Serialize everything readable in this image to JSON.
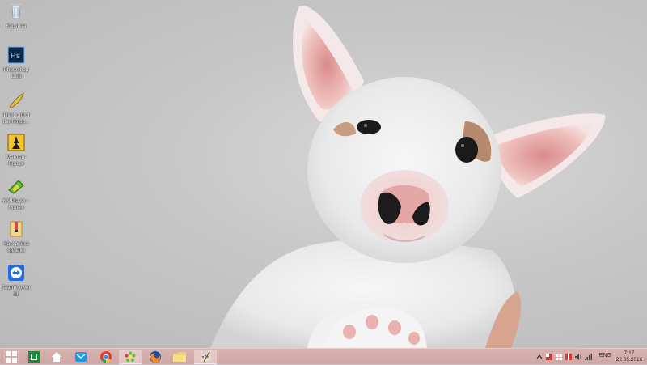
{
  "desktop": {
    "icons": [
      {
        "name": "recycle-bin",
        "label": "Корзина"
      },
      {
        "name": "photoshop",
        "label": "Photoshop CS6"
      },
      {
        "name": "lord-of-the-rings-game",
        "label": "The Lord of the Rings..."
      },
      {
        "name": "master-game",
        "label": "Мастер-Ярлык"
      },
      {
        "name": "kmplayer",
        "label": "KMPlayer - Ярлык"
      },
      {
        "name": "neat-archive",
        "label": "Настройка ярлыки"
      },
      {
        "name": "teamviewer",
        "label": "TeamViewer 11"
      }
    ]
  },
  "taskbar": {
    "pinned": [
      {
        "name": "start",
        "icon": "windows-logo-icon"
      },
      {
        "name": "excel",
        "icon": "excel-icon"
      },
      {
        "name": "home",
        "icon": "home-icon"
      },
      {
        "name": "mail",
        "icon": "mail-icon"
      },
      {
        "name": "chrome",
        "icon": "chrome-icon"
      },
      {
        "name": "icq",
        "icon": "icq-flower-icon"
      },
      {
        "name": "firefox",
        "icon": "firefox-icon"
      },
      {
        "name": "explorer",
        "icon": "folder-icon"
      },
      {
        "name": "paint",
        "icon": "paint-palette-icon"
      }
    ],
    "tray": {
      "language": "ENG",
      "time": "7:17",
      "date": "22.05.2016"
    }
  },
  "colors": {
    "taskbar": "#d2aba8",
    "wallpaper": "#c7c7c7"
  }
}
